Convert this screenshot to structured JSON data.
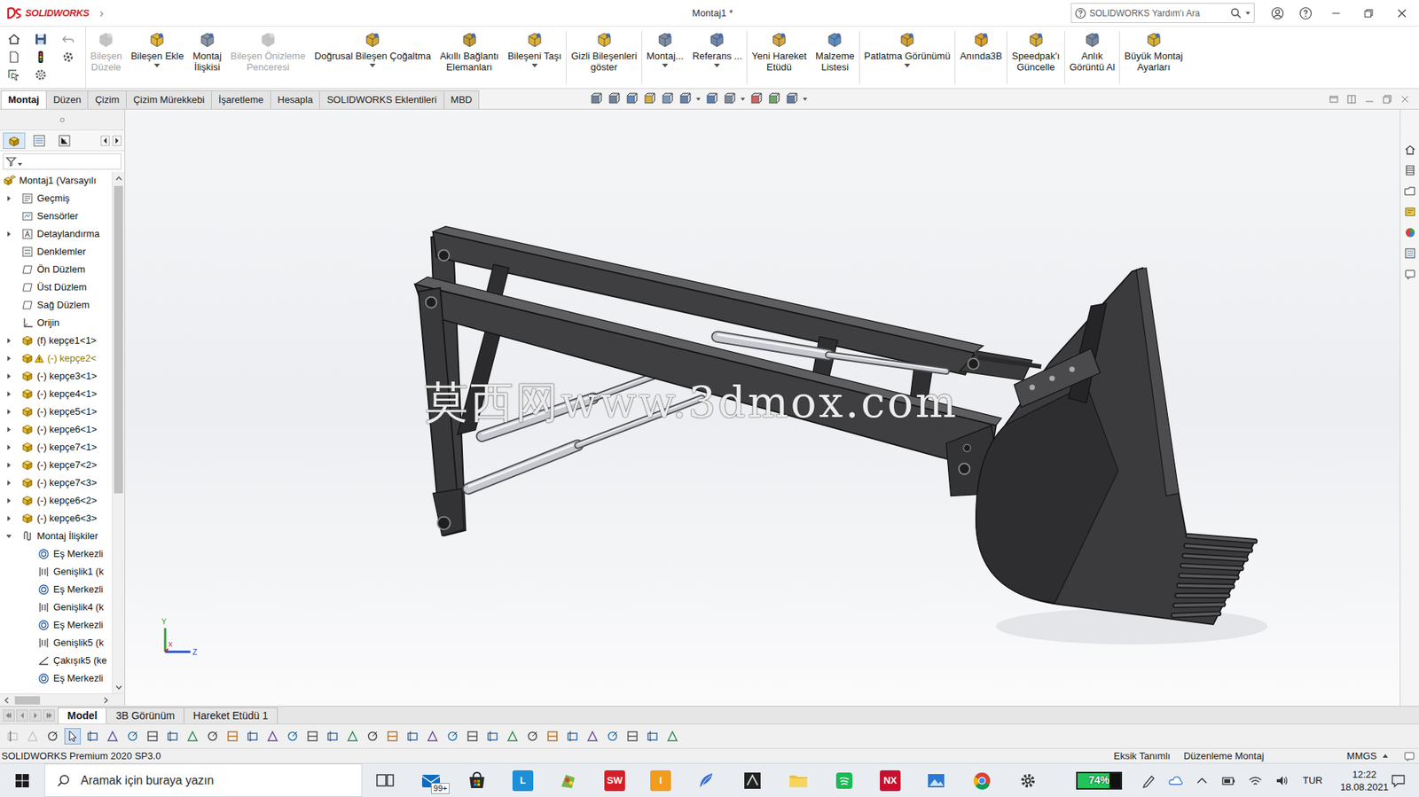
{
  "titlebar": {
    "logo": "SOLIDWORKS",
    "menu_arrow": "›",
    "title": "Montaj1 *",
    "search": {
      "placeholder": "SOLIDWORKS Yardım'ı Ara"
    }
  },
  "ribbon": {
    "buttons": [
      {
        "lines": [
          "Bileşen",
          "Düzele"
        ],
        "disabled": true,
        "dropdown": false
      },
      {
        "lines": [
          "Bileşen Ekle"
        ],
        "disabled": false,
        "dropdown": true
      },
      {
        "lines": [
          "Montaj",
          "İlişkisi"
        ],
        "disabled": false,
        "dropdown": false
      },
      {
        "lines": [
          "Bileşen Önizleme",
          "Penceresi"
        ],
        "disabled": true,
        "dropdown": false
      },
      {
        "lines": [
          "Doğrusal Bileşen Çoğaltma"
        ],
        "disabled": false,
        "dropdown": true
      },
      {
        "lines": [
          "Akıllı Bağlantı",
          "Elemanları"
        ],
        "disabled": false,
        "dropdown": false
      },
      {
        "lines": [
          "Bileşeni Taşı"
        ],
        "disabled": false,
        "dropdown": true
      },
      {
        "lines": [
          "Gizli Bileşenleri",
          "göster"
        ],
        "disabled": false,
        "dropdown": false
      },
      {
        "lines": [
          "Montaj..."
        ],
        "disabled": false,
        "dropdown": true
      },
      {
        "lines": [
          "Referans ..."
        ],
        "disabled": false,
        "dropdown": true
      },
      {
        "lines": [
          "Yeni Hareket",
          "Etüdü"
        ],
        "disabled": false,
        "dropdown": false
      },
      {
        "lines": [
          "Malzeme",
          "Listesi"
        ],
        "disabled": false,
        "dropdown": false
      },
      {
        "lines": [
          "Patlatma Görünümü"
        ],
        "disabled": false,
        "dropdown": true
      },
      {
        "lines": [
          "Anında3B"
        ],
        "disabled": false,
        "dropdown": false
      },
      {
        "lines": [
          "Speedpak'ı",
          "Güncelle"
        ],
        "disabled": false,
        "dropdown": false
      },
      {
        "lines": [
          "Anlık",
          "Görüntü Al"
        ],
        "disabled": false,
        "dropdown": false
      },
      {
        "lines": [
          "Büyük Montaj",
          "Ayarları"
        ],
        "disabled": false,
        "dropdown": false
      }
    ]
  },
  "tabs": [
    {
      "label": "Montaj",
      "selected": true
    },
    {
      "label": "Düzen",
      "selected": false
    },
    {
      "label": "Çizim",
      "selected": false
    },
    {
      "label": "Çizim Mürekkebi",
      "selected": false
    },
    {
      "label": "İşaretleme",
      "selected": false
    },
    {
      "label": "Hesapla",
      "selected": false
    },
    {
      "label": "SOLIDWORKS Eklentileri",
      "selected": false
    },
    {
      "label": "MBD",
      "selected": false
    }
  ],
  "tree": {
    "items": [
      {
        "label": "Montaj1  (Varsayılı",
        "kind": "assembly",
        "expander": "none",
        "warning": false
      },
      {
        "label": "Geçmiş",
        "kind": "history",
        "expander": "collapsed",
        "warning": false
      },
      {
        "label": "Sensörler",
        "kind": "sensor",
        "expander": "none",
        "warning": false
      },
      {
        "label": "Detaylandırma",
        "kind": "annotation",
        "expander": "collapsed",
        "warning": false
      },
      {
        "label": "Denklemler",
        "kind": "equation",
        "expander": "none",
        "warning": false
      },
      {
        "label": "Ön Düzlem",
        "kind": "plane",
        "expander": "none",
        "warning": false
      },
      {
        "label": "Üst Düzlem",
        "kind": "plane",
        "expander": "none",
        "warning": false
      },
      {
        "label": "Sağ Düzlem",
        "kind": "plane",
        "expander": "none",
        "warning": false
      },
      {
        "label": "Orijin",
        "kind": "origin",
        "expander": "none",
        "warning": false
      },
      {
        "label": "(f) kepçe1<1>",
        "kind": "part",
        "expander": "collapsed",
        "warning": false
      },
      {
        "label": "(-) kepçe2<",
        "kind": "part",
        "expander": "collapsed",
        "warning": true
      },
      {
        "label": "(-) kepçe3<1>",
        "kind": "part",
        "expander": "collapsed",
        "warning": false
      },
      {
        "label": "(-) kepçe4<1>",
        "kind": "part",
        "expander": "collapsed",
        "warning": false
      },
      {
        "label": "(-) kepçe5<1>",
        "kind": "part",
        "expander": "collapsed",
        "warning": false
      },
      {
        "label": "(-) kepçe6<1>",
        "kind": "part",
        "expander": "collapsed",
        "warning": false
      },
      {
        "label": "(-) kepçe7<1>",
        "kind": "part",
        "expander": "collapsed",
        "warning": false
      },
      {
        "label": "(-) kepçe7<2>",
        "kind": "part",
        "expander": "collapsed",
        "warning": false
      },
      {
        "label": "(-) kepçe7<3>",
        "kind": "part",
        "expander": "collapsed",
        "warning": false
      },
      {
        "label": "(-) kepçe6<2>",
        "kind": "part",
        "expander": "collapsed",
        "warning": false
      },
      {
        "label": "(-) kepçe6<3>",
        "kind": "part",
        "expander": "collapsed",
        "warning": false
      },
      {
        "label": "Montaj İlişkiler",
        "kind": "mates",
        "expander": "expanded",
        "warning": false
      },
      {
        "label": "Eş Merkezli",
        "kind": "concentric",
        "expander": "none",
        "warning": false
      },
      {
        "label": "Genişlik1 (k",
        "kind": "width",
        "expander": "none",
        "warning": false
      },
      {
        "label": "Eş Merkezli",
        "kind": "concentric",
        "expander": "none",
        "warning": false
      },
      {
        "label": "Genişlik4 (k",
        "kind": "width",
        "expander": "none",
        "warning": false
      },
      {
        "label": "Eş Merkezli",
        "kind": "concentric",
        "expander": "none",
        "warning": false
      },
      {
        "label": "Genişlik5 (k",
        "kind": "width",
        "expander": "none",
        "warning": false
      },
      {
        "label": "Çakışık5 (ke",
        "kind": "coincident",
        "expander": "none",
        "warning": false
      },
      {
        "label": "Eş Merkezli",
        "kind": "concentric",
        "expander": "none",
        "warning": false
      }
    ]
  },
  "viewport": {
    "watermark": "莫西网www.3dmox.com",
    "triad": {
      "y": "Y",
      "x": "X",
      "z": "Z"
    }
  },
  "bottom_tabs": [
    {
      "label": "Model",
      "selected": true
    },
    {
      "label": "3B Görünüm",
      "selected": false
    },
    {
      "label": "Hareket Etüdü 1",
      "selected": false
    }
  ],
  "status_bar": {
    "product": "SOLIDWORKS Premium 2020 SP3.0",
    "state": "Eksik Tanımlı",
    "mode": "Düzenleme Montaj",
    "units": "MMGS"
  },
  "taskbar": {
    "search": {
      "placeholder": "Aramak için buraya yazın"
    },
    "mail_badge": "99+",
    "labels": {
      "launcher": "L",
      "solidworks": "SW",
      "office": "I",
      "nx": "NX"
    },
    "battery": {
      "reading": "74%",
      "level": 0.74
    },
    "language": "TUR",
    "time": "12:22",
    "date": "18.08.2021"
  }
}
